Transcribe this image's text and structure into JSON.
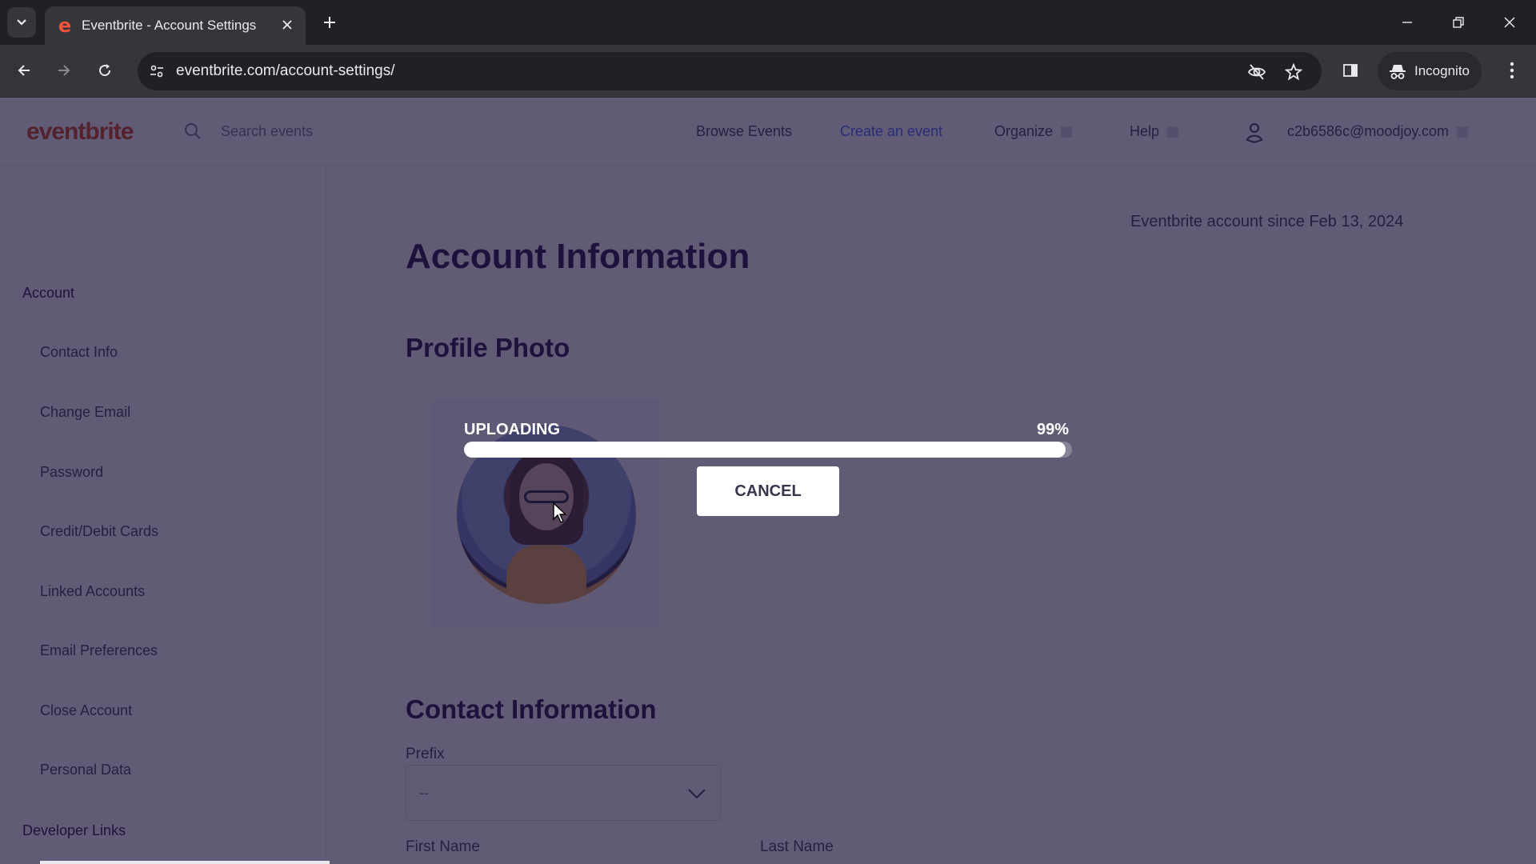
{
  "browser": {
    "tab_title": "Eventbrite - Account Settings",
    "favicon_glyph": "e",
    "url": "eventbrite.com/account-settings/",
    "incognito_label": "Incognito",
    "icons": {
      "tab_search": "chevron-down-icon",
      "close_tab": "close-icon",
      "new_tab": "plus-icon",
      "back": "arrow-left-icon",
      "forward": "arrow-right-icon",
      "reload": "reload-icon",
      "site_info": "tune-icon",
      "tracking": "eye-off-icon",
      "bookmark": "star-icon",
      "side_panel": "side-panel-icon",
      "incognito": "incognito-icon",
      "menu": "kebab-menu-icon",
      "minimize": "minimize-icon",
      "restore": "restore-icon",
      "close_window": "close-icon"
    }
  },
  "header": {
    "logo": "eventbrite",
    "search_placeholder": "Search events",
    "nav": [
      {
        "label": "Browse Events"
      },
      {
        "label": "Create an event"
      },
      {
        "label": "Organize"
      },
      {
        "label": "Help"
      }
    ],
    "user_email": "c2b6586c@moodjoy.com"
  },
  "sidebar": {
    "group_account": "Account",
    "items": [
      {
        "label": "Contact Info"
      },
      {
        "label": "Change Email"
      },
      {
        "label": "Password"
      },
      {
        "label": "Credit/Debit Cards"
      },
      {
        "label": "Linked Accounts"
      },
      {
        "label": "Email Preferences"
      },
      {
        "label": "Close Account"
      },
      {
        "label": "Personal Data"
      }
    ],
    "group_developer": "Developer Links"
  },
  "main": {
    "title": "Account Information",
    "member_since": "Eventbrite account since Feb 13, 2024",
    "profile_photo_heading": "Profile Photo",
    "contact_heading": "Contact Information",
    "prefix_label": "Prefix",
    "prefix_value": "--",
    "first_name_label": "First Name",
    "last_name_label": "Last Name"
  },
  "upload": {
    "status_label": "UPLOADING",
    "percent_label": "99%",
    "progress_percent": 99,
    "cancel_label": "CANCEL"
  },
  "colors": {
    "brand": "#d1410c",
    "link_accent": "#3d64ff",
    "overlay": "#1e163c"
  }
}
